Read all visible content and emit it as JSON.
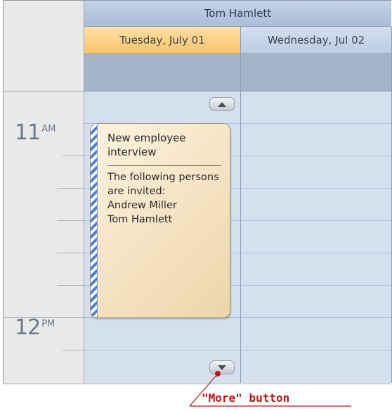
{
  "resource": {
    "name": "Tom Hamlett"
  },
  "days": [
    {
      "label": "Tuesday, July 01",
      "selected": true
    },
    {
      "label": "Wednesday, Jul 02",
      "selected": false
    }
  ],
  "time_ruler": [
    {
      "hour": "11",
      "ampm": "AM"
    },
    {
      "hour": "12",
      "ampm": "PM"
    }
  ],
  "appointment": {
    "subject": "New employee interview",
    "description": "The following persons are invited:\nAndrew Miller\nTom Hamlett",
    "label_color": "#4a7fd6"
  },
  "callout": {
    "text": "\"More\" button",
    "color": "#b5161b"
  },
  "colors": {
    "selected_day": "#f7c466",
    "cell": "#d5e0ee",
    "allday": "#a3b4cb"
  }
}
